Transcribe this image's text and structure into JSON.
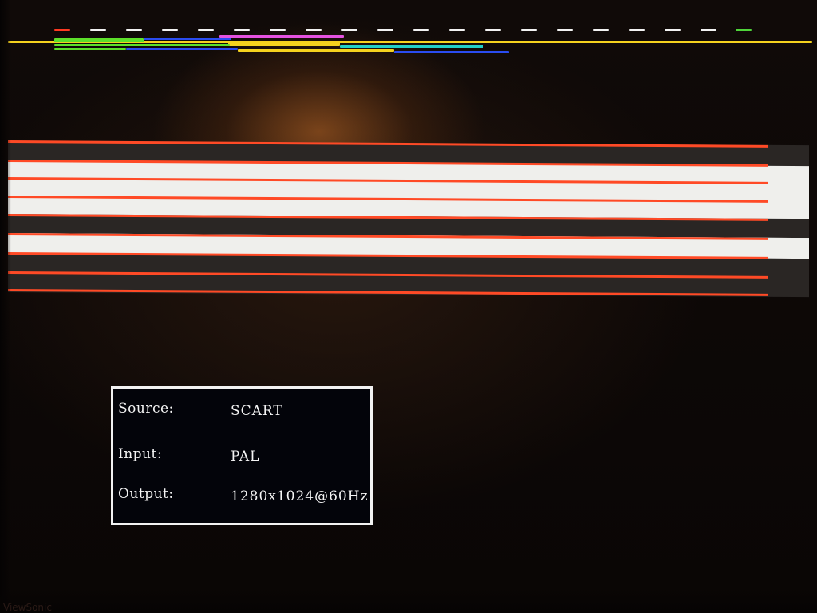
{
  "osd": {
    "rows": [
      {
        "label": "Source:",
        "value": "SCART"
      },
      {
        "label": "Input:",
        "value": "PAL"
      },
      {
        "label": "Output:",
        "value": "1280x1024@60Hz"
      }
    ]
  },
  "brand": "ViewSonic",
  "colors": {
    "osd_border": "#f2f2f2",
    "osd_background": "#03040a",
    "stripe_red": "#ff4a26",
    "stripe_light": "#efefec",
    "stripe_dark": "#2a2624",
    "indicator_yellow": "#f5d21e",
    "indicator_green": "#5de02a",
    "indicator_blue": "#2a4cf0",
    "indicator_magenta": "#e552e0",
    "indicator_cyan": "#22d0c8",
    "indicator_white": "#f2f2f2"
  }
}
